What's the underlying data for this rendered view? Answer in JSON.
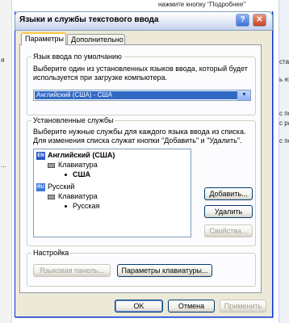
{
  "background": {
    "top_text": "нажмите кнопку \"Подробнее\"",
    "right_fragments": [
      "ст",
      "стане",
      "ь язы",
      "с по",
      "с ра",
      "с по",
      "с ра"
    ],
    "left_fragments": [
      "я",
      "..."
    ]
  },
  "dialog": {
    "title": "Языки и службы текстового ввода",
    "tabs": [
      "Параметры",
      "Дополнительно"
    ],
    "default_lang_group": {
      "legend": "Язык ввода по умолчанию",
      "description": "Выберите один из установленных языков ввода, который будет используется при загрузке компьютера.",
      "selected": "Английский (США) - США"
    },
    "services_group": {
      "legend": "Установленные службы",
      "description": "Выберите нужные службы для каждого языка ввода из списка. Для изменения списка служат кнопки \"Добавить\" и \"Удалить\".",
      "tree": [
        {
          "badge": "EN",
          "lang": "Английский (США)",
          "category": "Клавиатура",
          "layout": "США"
        },
        {
          "badge": "RU",
          "lang": "Русский",
          "category": "Клавиатура",
          "layout": "Русская"
        }
      ],
      "buttons": {
        "add": "Добавить...",
        "remove": "Удалить",
        "properties": "Свойства..."
      }
    },
    "settings_group": {
      "legend": "Настройка",
      "lang_bar": "Языковая панель...",
      "kbd_params": "Параметры клавиатуры..."
    },
    "footer": {
      "ok": "OK",
      "cancel": "Отмена",
      "apply": "Применить"
    }
  }
}
